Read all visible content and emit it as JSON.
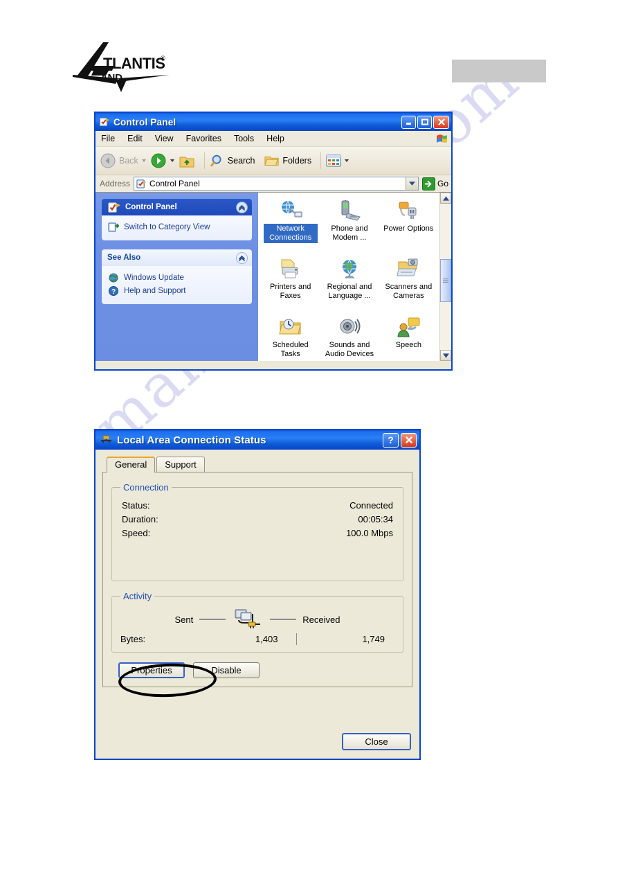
{
  "header": {
    "logo_primary": "TLANTIS",
    "logo_registered": "®",
    "logo_secondary": "AND",
    "redacted_label": ""
  },
  "watermark": {
    "text": "manualshive.com"
  },
  "control_panel_window": {
    "title": "Control Panel",
    "title_icon": "control-panel-icon",
    "window_buttons": [
      {
        "name": "minimize",
        "glyph": "_"
      },
      {
        "name": "maximize",
        "glyph": "□"
      },
      {
        "name": "close",
        "glyph": "✕"
      }
    ],
    "menu": [
      "File",
      "Edit",
      "View",
      "Favorites",
      "Tools",
      "Help"
    ],
    "toolbar": {
      "back_label": "Back",
      "forward_label": "",
      "up_label": "",
      "search_label": "Search",
      "folders_label": "Folders",
      "views_label": ""
    },
    "address": {
      "label": "Address",
      "value": "Control Panel",
      "go_label": "Go"
    },
    "left_panel": {
      "task_panel": {
        "header": "Control Panel",
        "header_icon": "control-panel-icon",
        "items": [
          {
            "label": "Switch to Category View",
            "icon": "switch-view-icon"
          }
        ]
      },
      "see_also_panel": {
        "header": "See Also",
        "items": [
          {
            "label": "Windows Update",
            "icon": "windows-update-icon"
          },
          {
            "label": "Help and Support",
            "icon": "help-support-icon"
          }
        ]
      }
    },
    "icons": [
      {
        "label": "Network Connections",
        "icon": "network-connections-icon",
        "selected": true
      },
      {
        "label": "Phone and Modem ...",
        "icon": "phone-modem-icon",
        "selected": false
      },
      {
        "label": "Power Options",
        "icon": "power-options-icon",
        "selected": false
      },
      {
        "label": "Printers and Faxes",
        "icon": "printers-faxes-icon",
        "selected": false
      },
      {
        "label": "Regional and Language ...",
        "icon": "regional-language-icon",
        "selected": false
      },
      {
        "label": "Scanners and Cameras",
        "icon": "scanners-cameras-icon",
        "selected": false
      },
      {
        "label": "Scheduled Tasks",
        "icon": "scheduled-tasks-icon",
        "selected": false
      },
      {
        "label": "Sounds and Audio Devices",
        "icon": "sounds-audio-icon",
        "selected": false
      },
      {
        "label": "Speech",
        "icon": "speech-icon",
        "selected": false
      }
    ]
  },
  "status_dialog": {
    "title": "Local Area Connection Status",
    "title_icon": "network-adapter-icon",
    "help_button": "?",
    "close_button": "✕",
    "tabs": [
      {
        "label": "General",
        "active": true
      },
      {
        "label": "Support",
        "active": false
      }
    ],
    "connection_group": {
      "legend": "Connection",
      "rows": [
        {
          "key": "Status:",
          "value": "Connected"
        },
        {
          "key": "Duration:",
          "value": "00:05:34"
        },
        {
          "key": "Speed:",
          "value": "100.0 Mbps"
        }
      ]
    },
    "activity_group": {
      "legend": "Activity",
      "sent_label": "Sent",
      "received_label": "Received",
      "bytes_label": "Bytes:",
      "sent_value": "1,403",
      "received_value": "1,749"
    },
    "buttons": {
      "properties": "Properties",
      "disable": "Disable",
      "close": "Close"
    },
    "annotation": {
      "target": "Properties",
      "shape": "ellipse"
    }
  },
  "colors": {
    "titlebar_blue": "#0a46c8",
    "selection_blue": "#316ac5",
    "panel_face": "#ece9d8",
    "left_panel_blue": "#6b8ee3",
    "legend_blue": "#1f4fb4",
    "redaction_gray": "#c9c9c9",
    "watermark_purple": "#bcbde8"
  }
}
